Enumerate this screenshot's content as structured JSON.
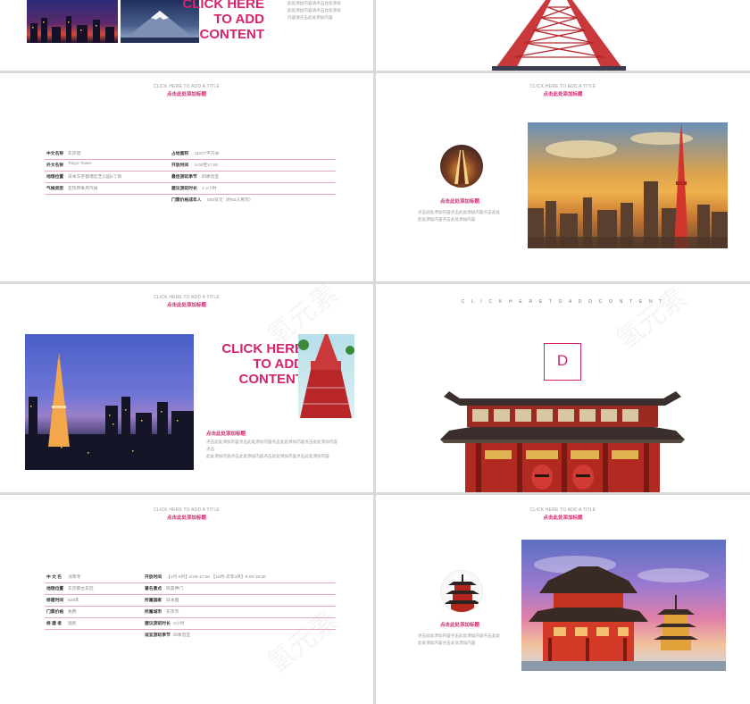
{
  "slides": {
    "s1": {
      "big_text": [
        "CLICK HERE",
        "TO ADD",
        "CONTENT"
      ],
      "body": [
        "此处添加内容请点击此处添加",
        "此处添加内容请点击此处添加",
        "内容请点击此处添加内容"
      ]
    },
    "s3": {
      "title": "CLICK HERE TO ADD A TITLE",
      "subtitle": "点击此处添加标题",
      "rows": [
        {
          "k1": "中文名称",
          "v1": "东京塔",
          "k2": "占地面积",
          "v2": "11577平方米"
        },
        {
          "k1": "外文名称",
          "v1": "Tokyo Tower",
          "k2": "开放时间",
          "v2": "9:00至17:00"
        },
        {
          "k1": "地理位置",
          "v1": "日本东京都港区芝公园4丁目",
          "k2": "最佳游玩季节",
          "v2": "四季皆宜"
        },
        {
          "k1": "气候类型",
          "v1": "亚热带季风气候",
          "k2": "建议游玩时长",
          "v2": "1-2小时"
        },
        {
          "k1": "",
          "v1": "",
          "k2": "门票价格成年人",
          "v2": "820日元（约63人民币）"
        }
      ]
    },
    "s4": {
      "title": "CLICK HERE TO ADD A TITLE",
      "subtitle": "点击此处添加标题",
      "caption": "点击此处添加标题",
      "body": [
        "点击此处添加内容点击此处添加内容点击此处",
        "此处添加内容点击此处添加内容"
      ]
    },
    "s5": {
      "title": "CLICK HERE TO ADD A TITLE",
      "subtitle": "点击此处添加标题",
      "big_text": [
        "CLICK HERE",
        "TO ADD",
        "CONTENT"
      ],
      "caption": "点击此处添加标题",
      "body": [
        "点击此处添加内容点击此处添加内容点击此处添加内容点击此处添加内容点击",
        "此处添加内容点击此处添加内容点击此处添加内容点击此处添加内容"
      ]
    },
    "s6": {
      "spaced_title": "C L I C K H E R E T O A D D C O N T E N T",
      "letter": "D"
    },
    "s7": {
      "title": "CLICK HERE TO ADD A TITLE",
      "subtitle": "点击此处添加标题",
      "rows": [
        {
          "k1": "中  文  名",
          "v1": "浅草寺",
          "k2": "开放时间",
          "v2": "【4月-9月】6:00-17:00   【10月-次年3月】6:00-18:30"
        },
        {
          "k1": "地理位置",
          "v1": "东京都台东区",
          "k2": "著名景点",
          "v2": "风雷神门"
        },
        {
          "k1": "修建时间",
          "v1": "628年",
          "k2": "所属国家",
          "v2": "日本国"
        },
        {
          "k1": "门票价格",
          "v1": "免费",
          "k2": "所属城市",
          "v2": "东京市"
        },
        {
          "k1": "修  建  者",
          "v1": "渔民",
          "k2": "建议游玩时长",
          "v2": "3小时"
        },
        {
          "k1": "",
          "v1": "",
          "k2": "适宜游玩季节",
          "v2": "四季皆宜"
        }
      ]
    },
    "s8": {
      "title": "CLICK HERE TO ADD A TITLE",
      "subtitle": "点击此处添加标题",
      "caption": "点击此处添加标题",
      "body": [
        "点击此处添加内容点击此处添加内容点击此处",
        "此处添加内容点击此处添加内容"
      ]
    }
  },
  "watermark_text": "氢元素",
  "colors": {
    "accent": "#d6246f",
    "bg": "#d9d9d9"
  }
}
